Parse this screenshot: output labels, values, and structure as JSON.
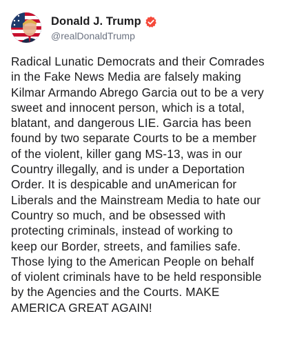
{
  "author": {
    "display_name": "Donald J. Trump",
    "handle": "@realDonaldTrump",
    "verified": true,
    "verified_color": "#f5493a",
    "avatar_icon": "flag-portrait-avatar"
  },
  "post": {
    "text": "Radical Lunatic Democrats and their Comrades\nin the Fake News Media are falsely making\nKilmar Armando Abrego Garcia out to be a very\nsweet and innocent person, which is a total,\nblatant, and dangerous LIE. Garcia has been\nfound by two separate Courts to be a member\nof the violent, killer gang MS-13, was in our\nCountry illegally, and is under a Deportation\nOrder. It is despicable and unAmerican for\nLiberals and the Mainstream Media to hate our\nCountry so much, and be obsessed with\nprotecting criminals, instead of working to\nkeep our Border, streets, and families safe.\nThose lying to the American People on behalf\nof violent criminals have to be held responsible\nby the Agencies and the Courts. MAKE\nAMERICA GREAT AGAIN!"
  }
}
